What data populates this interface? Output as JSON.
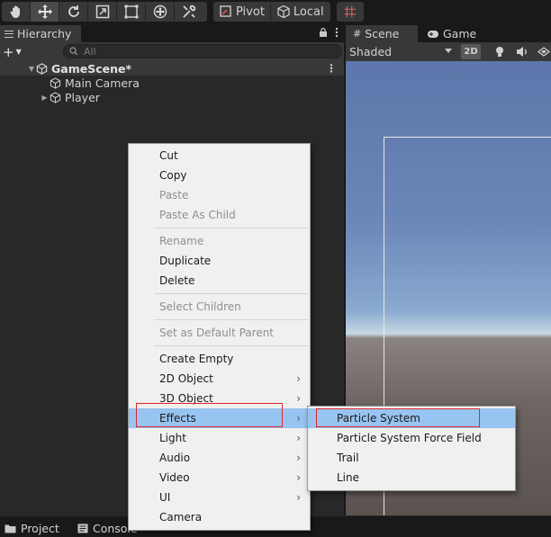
{
  "toolbar": {
    "tools": [
      "hand-icon",
      "move-icon",
      "rotate-icon",
      "scale-icon",
      "rect-icon",
      "transform-icon",
      "custom-tools-icon"
    ],
    "active_tool": "move-icon",
    "pivot_label": "Pivot",
    "local_label": "Local"
  },
  "hierarchy": {
    "tab_label": "Hierarchy",
    "add_symbol": "+",
    "search_placeholder": "All",
    "scene_name": "GameScene*",
    "objects": [
      "Main Camera",
      "Player"
    ]
  },
  "scene_view": {
    "tabs": [
      "Scene",
      "Game"
    ],
    "shading_mode": "Shaded",
    "toggle_2d": "2D"
  },
  "bottom": {
    "tabs": [
      "Project",
      "Console"
    ]
  },
  "context_menu": {
    "items": {
      "cut": "Cut",
      "copy": "Copy",
      "paste": "Paste",
      "paste_as_child": "Paste As Child",
      "rename": "Rename",
      "duplicate": "Duplicate",
      "delete": "Delete",
      "select_children": "Select Children",
      "set_default_parent": "Set as Default Parent",
      "create_empty": "Create Empty",
      "object_2d": "2D Object",
      "object_3d": "3D Object",
      "effects": "Effects",
      "light": "Light",
      "audio": "Audio",
      "video": "Video",
      "ui": "UI",
      "camera": "Camera"
    },
    "submenu_arrow": "›"
  },
  "effects_submenu": {
    "items": [
      "Particle System",
      "Particle System Force Field",
      "Trail",
      "Line"
    ]
  },
  "colors": {
    "highlight": "#97c4f0",
    "annotation_red": "#e0262c",
    "menu_bg": "#f0f0f0"
  }
}
